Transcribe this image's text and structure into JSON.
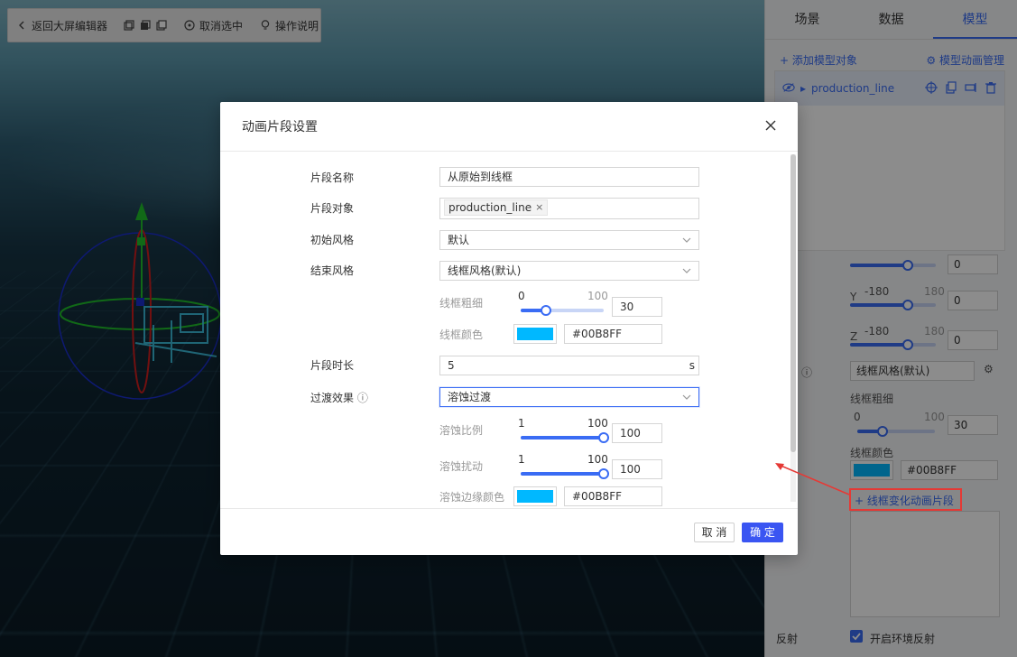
{
  "toolbar": {
    "back_label": "返回大屏编辑器",
    "deselect_label": "取消选中",
    "help_label": "操作说明"
  },
  "right_panel": {
    "tabs": [
      "场景",
      "数据",
      "模型"
    ],
    "active_tab": "模型",
    "add_object_label": "+ 添加模型对象",
    "animation_manage_label": "模型动画管理",
    "object_name": "production_line",
    "y_label": "Y",
    "z_label": "Z",
    "y_min": "-180",
    "y_max": "180",
    "y_value": "0",
    "z_min": "-180",
    "z_max": "180",
    "z_value": "0",
    "top_value": "0",
    "style_select": "线框风格(默认)",
    "wire_thickness_label": "线框粗细",
    "wire_min": "0",
    "wire_max": "100",
    "wire_value": "30",
    "wire_color_label": "线框颜色",
    "wire_color_hex": "#00B8FF",
    "add_anim_label": "线框变化动画片段",
    "reflection_label": "反射",
    "env_reflection_label": "开启环境反射"
  },
  "modal": {
    "title": "动画片段设置",
    "fields": {
      "clip_name_label": "片段名称",
      "clip_name_value": "从原始到线框",
      "clip_target_label": "片段对象",
      "clip_target_tag": "production_line",
      "start_style_label": "初始风格",
      "start_style_value": "默认",
      "end_style_label": "结束风格",
      "end_style_value": "线框风格(默认)",
      "wire_thickness_label": "线框粗细",
      "wire_min": "0",
      "wire_max": "100",
      "wire_value": "30",
      "wire_color_label": "线框颜色",
      "wire_color_hex": "#00B8FF",
      "duration_label": "片段时长",
      "duration_value": "5",
      "duration_unit": "s",
      "transition_label": "过渡效果",
      "transition_value": "溶蚀过渡",
      "dissolve_ratio_label": "溶蚀比例",
      "dissolve_ratio_min": "1",
      "dissolve_ratio_max": "100",
      "dissolve_ratio_value": "100",
      "dissolve_disturb_label": "溶蚀扰动",
      "dissolve_disturb_min": "1",
      "dissolve_disturb_max": "100",
      "dissolve_disturb_value": "100",
      "dissolve_edge_color_label": "溶蚀边缘颜色",
      "dissolve_edge_color_hex": "#00B8FF"
    },
    "cancel_label": "取 消",
    "ok_label": "确 定"
  },
  "colors": {
    "accent": "#3a6cf4",
    "primary_button": "#3a55f2",
    "wire_color": "#00B8FF",
    "annotation": "#e53935"
  }
}
